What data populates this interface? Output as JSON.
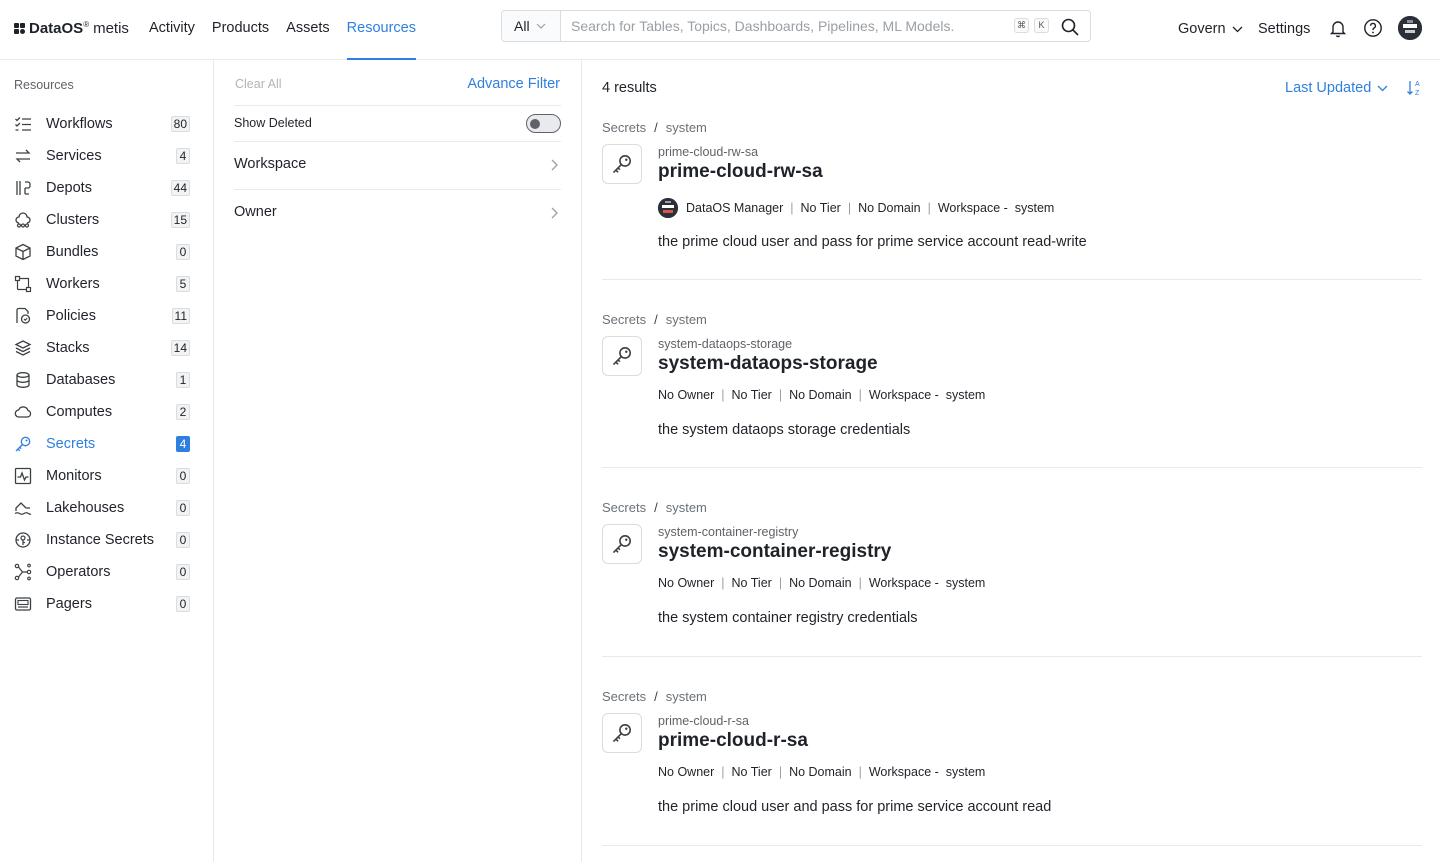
{
  "brand": {
    "name": "DataOS",
    "registered": "®",
    "product": "metis"
  },
  "nav": [
    {
      "label": "Activity"
    },
    {
      "label": "Products"
    },
    {
      "label": "Assets"
    },
    {
      "label": "Resources",
      "active": true
    }
  ],
  "search": {
    "scope": "All",
    "placeholder": "Search for Tables, Topics, Dashboards, Pipelines, ML Models.",
    "shortcut_keys": [
      "⌘",
      "K"
    ]
  },
  "header_right": {
    "govern": "Govern",
    "settings": "Settings"
  },
  "sidebar": {
    "title": "Resources",
    "items": [
      {
        "label": "Workflows",
        "count": "80",
        "icon": "workflow-icon"
      },
      {
        "label": "Services",
        "count": "4",
        "icon": "services-icon"
      },
      {
        "label": "Depots",
        "count": "44",
        "icon": "depot-icon"
      },
      {
        "label": "Clusters",
        "count": "15",
        "icon": "cluster-icon"
      },
      {
        "label": "Bundles",
        "count": "0",
        "icon": "bundle-icon"
      },
      {
        "label": "Workers",
        "count": "5",
        "icon": "worker-icon"
      },
      {
        "label": "Policies",
        "count": "11",
        "icon": "policy-icon"
      },
      {
        "label": "Stacks",
        "count": "14",
        "icon": "stack-icon"
      },
      {
        "label": "Databases",
        "count": "1",
        "icon": "database-icon"
      },
      {
        "label": "Computes",
        "count": "2",
        "icon": "cloud-icon"
      },
      {
        "label": "Secrets",
        "count": "4",
        "icon": "key-icon",
        "active": true
      },
      {
        "label": "Monitors",
        "count": "0",
        "icon": "monitor-icon"
      },
      {
        "label": "Lakehouses",
        "count": "0",
        "icon": "lakehouse-icon"
      },
      {
        "label": "Instance Secrets",
        "count": "0",
        "icon": "instance-secret-icon"
      },
      {
        "label": "Operators",
        "count": "0",
        "icon": "operator-icon"
      },
      {
        "label": "Pagers",
        "count": "0",
        "icon": "pager-icon"
      }
    ]
  },
  "filters": {
    "clear_all": "Clear All",
    "advance_filter": "Advance Filter",
    "show_deleted": "Show Deleted",
    "show_deleted_on": false,
    "groups": [
      "Workspace",
      "Owner"
    ]
  },
  "results": {
    "count_label": "4 results",
    "sort_label": "Last Updated",
    "items": [
      {
        "crumb_type": "Secrets",
        "crumb_workspace": "system",
        "subtitle": "prime-cloud-rw-sa",
        "name": "prime-cloud-rw-sa",
        "owner": "DataOS Manager",
        "has_owner_avatar": true,
        "tier": "No Tier",
        "domain": "No Domain",
        "workspace_label": "Workspace -",
        "workspace": "system",
        "description": "the prime cloud user and pass for prime service account read-write"
      },
      {
        "crumb_type": "Secrets",
        "crumb_workspace": "system",
        "subtitle": "system-dataops-storage",
        "name": "system-dataops-storage",
        "owner": "No Owner",
        "has_owner_avatar": false,
        "tier": "No Tier",
        "domain": "No Domain",
        "workspace_label": "Workspace -",
        "workspace": "system",
        "description": "the system dataops storage credentials"
      },
      {
        "crumb_type": "Secrets",
        "crumb_workspace": "system",
        "subtitle": "system-container-registry",
        "name": "system-container-registry",
        "owner": "No Owner",
        "has_owner_avatar": false,
        "tier": "No Tier",
        "domain": "No Domain",
        "workspace_label": "Workspace -",
        "workspace": "system",
        "description": "the system container registry credentials"
      },
      {
        "crumb_type": "Secrets",
        "crumb_workspace": "system",
        "subtitle": "prime-cloud-r-sa",
        "name": "prime-cloud-r-sa",
        "owner": "No Owner",
        "has_owner_avatar": false,
        "tier": "No Tier",
        "domain": "No Domain",
        "workspace_label": "Workspace -",
        "workspace": "system",
        "description": "the prime cloud user and pass for prime service account read"
      }
    ]
  },
  "colors": {
    "accent": "#2f7fe0",
    "text": "#1f2329",
    "muted": "#6b7178",
    "border": "#e8eaed"
  }
}
